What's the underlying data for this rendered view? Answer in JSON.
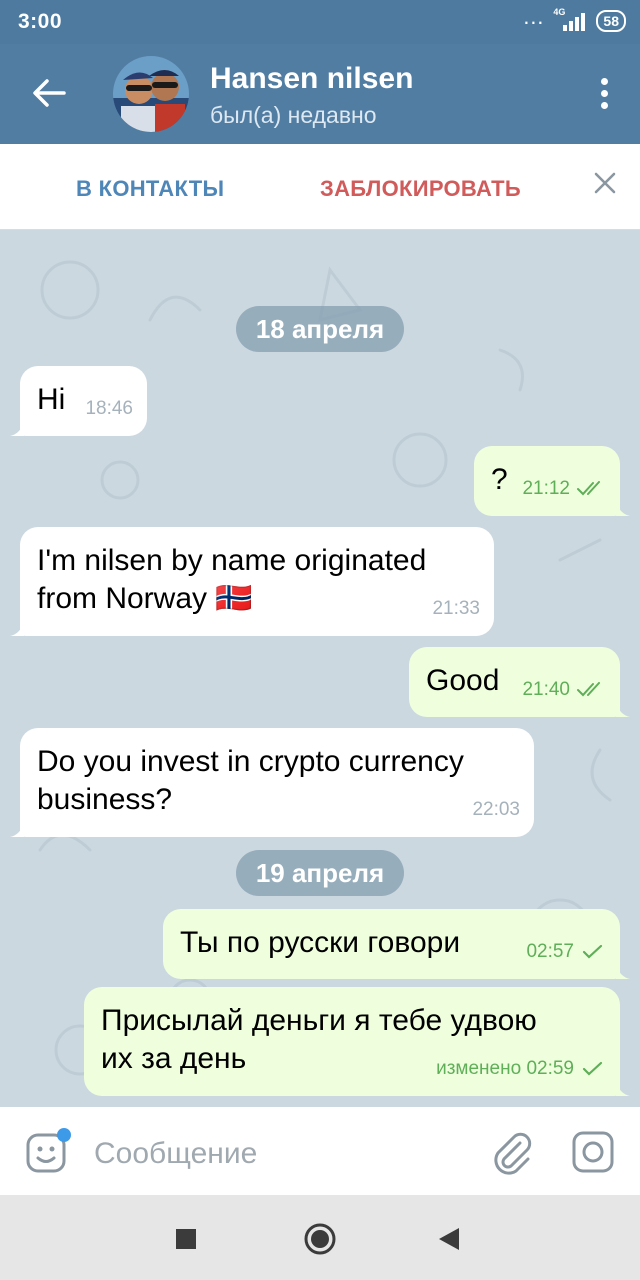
{
  "status_bar": {
    "time": "3:00",
    "network": "4G",
    "battery": "58"
  },
  "header": {
    "title": "Hansen nilsen",
    "subtitle": "был(а) недавно"
  },
  "action_bar": {
    "add_contact_label": "В КОНТАКТЫ",
    "block_label": "ЗАБЛОКИРОВАТЬ"
  },
  "chat": {
    "dates": [
      "18 апреля",
      "19 апреля"
    ],
    "messages": [
      {
        "dir": "in",
        "lines": [
          "Hi"
        ],
        "time": "18:46"
      },
      {
        "dir": "out",
        "lines": [
          "?"
        ],
        "time": "21:12",
        "status": "read"
      },
      {
        "dir": "in",
        "lines": [
          "I'm nilsen by name originated",
          "from Norway 🇳🇴"
        ],
        "time": "21:33"
      },
      {
        "dir": "out",
        "lines": [
          "Good"
        ],
        "time": "21:40",
        "status": "read"
      },
      {
        "dir": "in",
        "lines": [
          "Do you invest in crypto currency",
          "business?"
        ],
        "time": "22:03"
      },
      {
        "dir": "out",
        "lines": [
          "Ты по русски говори"
        ],
        "time": "02:57",
        "status": "sent"
      },
      {
        "dir": "out",
        "lines": [
          "Присылай деньги я тебе удвою",
          "их за день"
        ],
        "time": "изменено 02:59",
        "status": "sent"
      }
    ]
  },
  "input": {
    "placeholder": "Сообщение"
  },
  "colors": {
    "header": "#517da2",
    "status_bar": "#4d7a9e",
    "in_bubble": "#ffffff",
    "out_bubble": "#efffde",
    "check": "#5fae58",
    "block": "#d15b5b",
    "contacts": "#4e86b8"
  },
  "icons": [
    "back-arrow-icon",
    "more-vert-icon",
    "close-icon",
    "emoji-icon",
    "attach-icon",
    "camera-icon",
    "double-check-icon",
    "single-check-icon"
  ]
}
